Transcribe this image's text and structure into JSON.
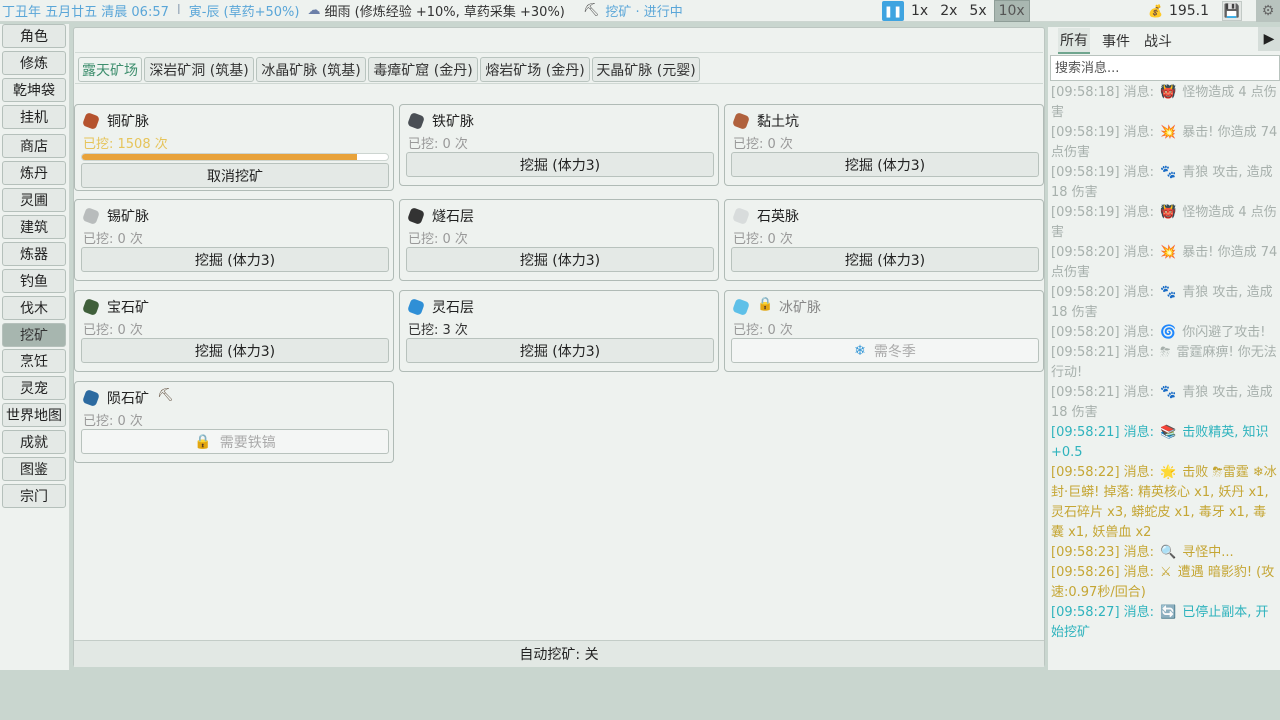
{
  "topbar": {
    "date": "丁丑年 五月廿五 清晨 06:57",
    "separator": "I",
    "period": "寅-辰 (草药+50%)",
    "weather": "细雨 (修炼经验 +10%, 草药采集 +30%)",
    "activity": "挖矿 · 进行中",
    "speeds": [
      "1x",
      "2x",
      "5x",
      "10x"
    ],
    "active_speed": "10x",
    "money": "195.1"
  },
  "sidebar": {
    "items": [
      "角色",
      "修炼",
      "乾坤袋",
      "挂机",
      "商店",
      "炼丹",
      "灵圃",
      "建筑",
      "炼器",
      "钓鱼",
      "伐木",
      "挖矿",
      "烹饪",
      "灵宠",
      "世界地图",
      "成就",
      "图鉴",
      "宗门"
    ],
    "active": "挖矿"
  },
  "tabs": [
    "露天矿场",
    "深岩矿洞 (筑基)",
    "冰晶矿脉 (筑基)",
    "毒瘴矿窟 (金丹)",
    "熔岩矿场 (金丹)",
    "天晶矿脉 (元婴)"
  ],
  "active_tab": "露天矿场",
  "cards": [
    {
      "name": "铜矿脉",
      "count": "已挖: 1508 次",
      "button": "取消挖矿",
      "progress": 0.9,
      "color": "#b5532e"
    },
    {
      "name": "铁矿脉",
      "count": "已挖: 0 次",
      "button": "挖掘 (体力3)",
      "color": "#4a4f55"
    },
    {
      "name": "黏土坑",
      "count": "已挖: 0 次",
      "button": "挖掘 (体力3)",
      "color": "#b0613d"
    },
    {
      "name": "锡矿脉",
      "count": "已挖: 0 次",
      "button": "挖掘 (体力3)",
      "color": "#b8bcbc"
    },
    {
      "name": "燧石层",
      "count": "已挖: 0 次",
      "button": "挖掘 (体力3)",
      "color": "#333"
    },
    {
      "name": "石英脉",
      "count": "已挖: 0 次",
      "button": "挖掘 (体力3)",
      "color": "#d8dcdc"
    },
    {
      "name": "宝石矿",
      "count": "已挖: 0 次",
      "button": "挖掘 (体力3)",
      "color": "#3f5f3a"
    },
    {
      "name": "灵石层",
      "count": "已挖: 3 次",
      "button": "挖掘 (体力3)",
      "color": "#2f8fd6"
    },
    {
      "name": "冰矿脉",
      "count": "已挖: 0 次",
      "button": "需冬季",
      "locked": true,
      "color": "#5ec0e8"
    },
    {
      "name": "陨石矿",
      "count": "已挖: 0 次",
      "button": "需要铁镐",
      "locked": true,
      "color": "#2c6aa0"
    }
  ],
  "auto_mining": "自动挖矿: 关",
  "log": {
    "tabs": [
      "所有",
      "事件",
      "战斗"
    ],
    "active_tab": "所有",
    "search_placeholder": "搜索消息...",
    "lines": [
      {
        "text": "[09:58:18] 消息:",
        "icon": "👹",
        "msg": "怪物造成 4 点伤害",
        "style": "grey"
      },
      {
        "text": "[09:58:19] 消息:",
        "icon": "💥",
        "msg": "暴击! 你造成 74 点伤害",
        "style": "grey"
      },
      {
        "text": "[09:58:19] 消息:",
        "icon": "🐾",
        "msg": "青狼 攻击, 造成 18 伤害",
        "style": "grey"
      },
      {
        "text": "[09:58:19] 消息:",
        "icon": "👹",
        "msg": "怪物造成 4 点伤害",
        "style": "grey"
      },
      {
        "text": "[09:58:20] 消息:",
        "icon": "💥",
        "msg": "暴击! 你造成 74 点伤害",
        "style": "grey"
      },
      {
        "text": "[09:58:20] 消息:",
        "icon": "🐾",
        "msg": "青狼 攻击, 造成 18 伤害",
        "style": "grey"
      },
      {
        "text": "[09:58:20] 消息:",
        "icon": "🌀",
        "msg": "你闪避了攻击!",
        "style": "grey"
      },
      {
        "text": "[09:58:21] 消息:",
        "icon": "⛈",
        "msg": "雷霆麻痹! 你无法行动!",
        "style": "grey"
      },
      {
        "text": "[09:58:21] 消息:",
        "icon": "🐾",
        "msg": "青狼 攻击, 造成 18 伤害",
        "style": "grey"
      },
      {
        "text": "[09:58:21] 消息:",
        "icon": "📚",
        "msg": "击败精英, 知识 +0.5",
        "style": "cyan"
      },
      {
        "text": "[09:58:22] 消息:",
        "icon": "🌟",
        "msg": "击败 ⛈雷霆 ❄冰封·巨蟒! 掉落: 精英核心 x1, 妖丹 x1, 灵石碎片 x3, 蟒蛇皮 x1, 毒牙 x1, 毒囊 x1, 妖兽血 x2",
        "style": "gold"
      },
      {
        "text": "[09:58:23] 消息:",
        "icon": "🔍",
        "msg": "寻怪中...",
        "style": "gold"
      },
      {
        "text": "[09:58:26] 消息:",
        "icon": "⚔",
        "msg": "遭遇 暗影豹! (攻速:0.97秒/回合)",
        "style": "gold"
      },
      {
        "text": "[09:58:27] 消息:",
        "icon": "🔄",
        "msg": "已停止副本, 开始挖矿",
        "style": "cyan"
      }
    ]
  }
}
